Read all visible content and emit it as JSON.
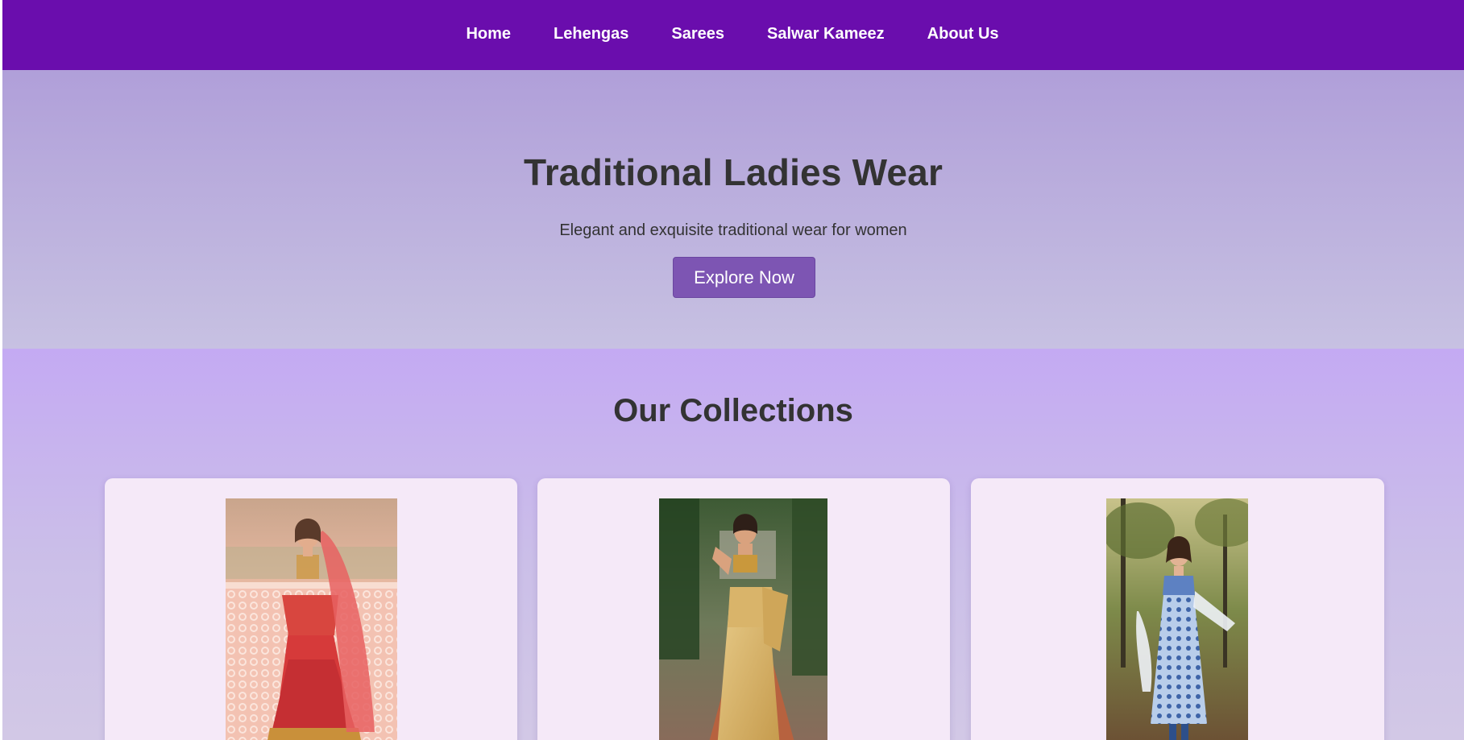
{
  "nav": {
    "items": [
      {
        "label": "Home"
      },
      {
        "label": "Lehengas"
      },
      {
        "label": "Sarees"
      },
      {
        "label": "Salwar Kameez"
      },
      {
        "label": "About Us"
      }
    ]
  },
  "hero": {
    "title": "Traditional Ladies Wear",
    "subtitle": "Elegant and exquisite traditional wear for women",
    "button_label": "Explore Now"
  },
  "collections": {
    "title": "Our Collections",
    "cards": [
      {
        "image_alt": "Lehenga"
      },
      {
        "image_alt": "Saree"
      },
      {
        "image_alt": "Salwar Kameez"
      }
    ]
  },
  "colors": {
    "nav_bg": "#6a0dad",
    "button_bg": "#7d55b3",
    "card_bg": "#f5e9f8",
    "text_dark": "#333333"
  }
}
